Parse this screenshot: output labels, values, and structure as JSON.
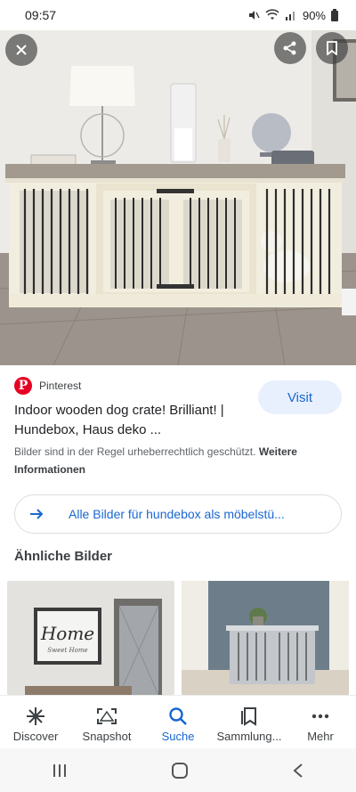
{
  "status_bar": {
    "time": "09:57",
    "battery": "90%",
    "icons": [
      "mute-icon",
      "wifi-icon",
      "signal-icon",
      "battery-icon"
    ]
  },
  "image_viewer": {
    "close_icon": "close-icon",
    "share_icon": "share-icon",
    "save_icon": "bookmark-icon"
  },
  "result": {
    "source": "Pinterest",
    "title": "Indoor wooden dog crate! Brilliant! | Hundebox, Haus deko ...",
    "visit_label": "Visit",
    "copyright_text": "Bilder sind in der Regel urheberrechtlich geschützt.",
    "more_info_label": "Weitere Informationen"
  },
  "all_images": {
    "label": "Alle Bilder für hundebox als möbelstü..."
  },
  "similar": {
    "heading": "Ähnliche Bilder",
    "thumb1_text": "Home",
    "thumb1_subtext": "Sweet Home"
  },
  "bottom_nav": {
    "items": [
      {
        "label": "Discover",
        "icon": "asterisk-icon"
      },
      {
        "label": "Snapshot",
        "icon": "snapshot-icon"
      },
      {
        "label": "Suche",
        "icon": "search-icon"
      },
      {
        "label": "Sammlung...",
        "icon": "collection-icon"
      },
      {
        "label": "Mehr",
        "icon": "more-icon"
      }
    ],
    "active_index": 2
  },
  "system_nav": {
    "icons": [
      "recents-icon",
      "home-icon",
      "back-icon"
    ]
  },
  "colors": {
    "accent": "#1967d2",
    "visit_bg": "#e8f0fe",
    "pinterest": "#e60023"
  }
}
